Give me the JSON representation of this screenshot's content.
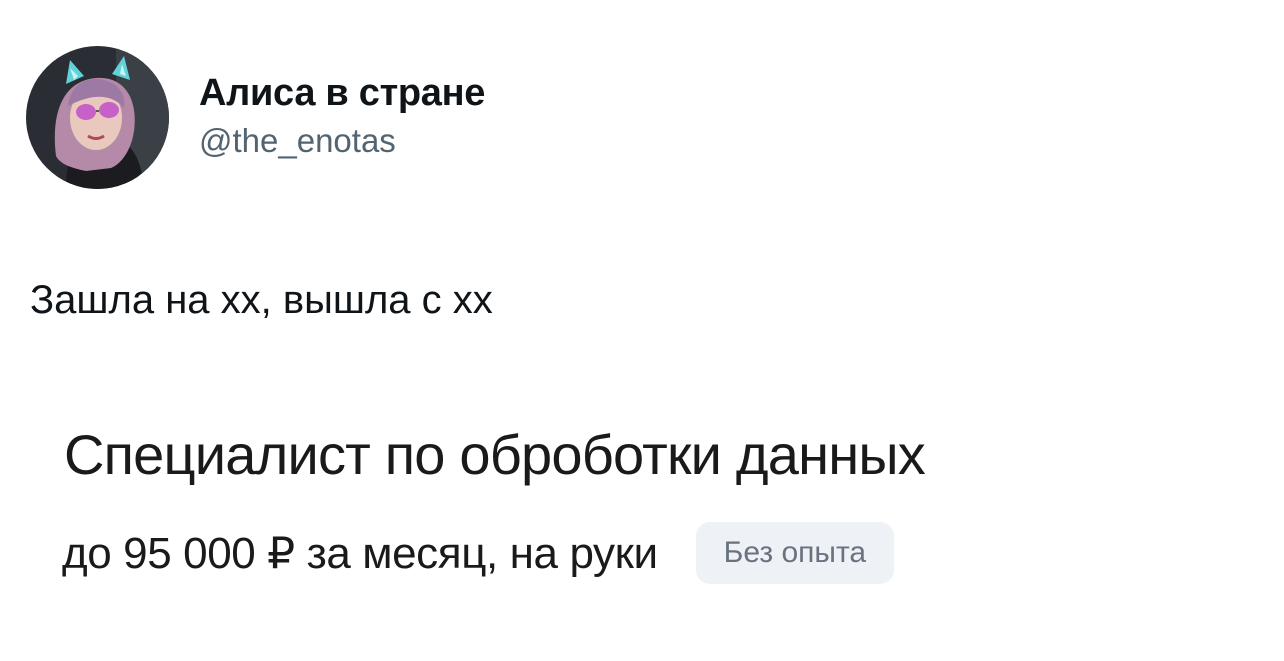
{
  "author": {
    "display_name": "Алиса в стране",
    "handle": "@the_enotas",
    "avatar_icon": "user-avatar-photo"
  },
  "tweet": {
    "text": "Зашла на хх, вышла с хх"
  },
  "media": {
    "job_title": "Специалист по оброботки данных",
    "salary": "до 95 000 ₽ за месяц, на руки",
    "experience_badge": "Без опыта"
  }
}
